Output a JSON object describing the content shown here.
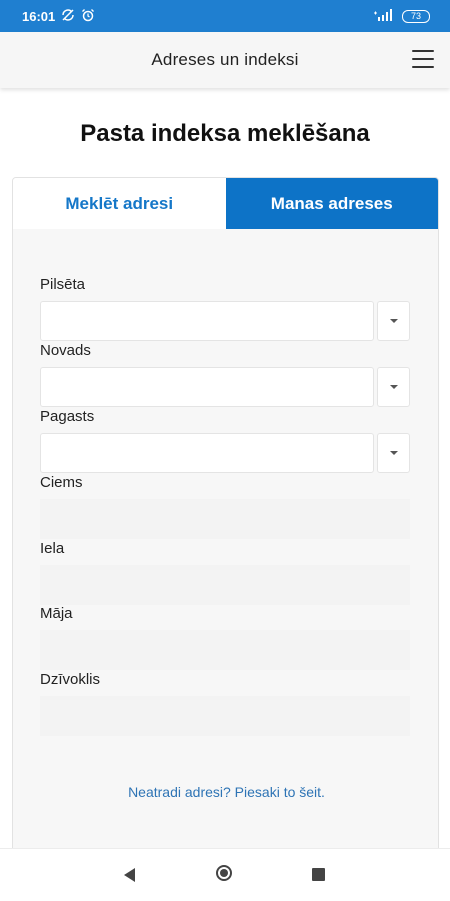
{
  "status_bar": {
    "time": "16:01",
    "battery": "73",
    "icons": [
      "sync-off-icon",
      "alarm-icon",
      "signal-icon",
      "battery-icon"
    ]
  },
  "app_bar": {
    "title": "Adreses un indeksi",
    "menu_icon": "hamburger-menu-icon"
  },
  "page": {
    "title": "Pasta indeksa meklēšana"
  },
  "tabs": [
    {
      "label": "Meklēt adresi",
      "active": true
    },
    {
      "label": "Manas adreses",
      "active": false
    }
  ],
  "form": {
    "fields": [
      {
        "label": "Pilsēta",
        "value": "",
        "type": "select"
      },
      {
        "label": "Novads",
        "value": "",
        "type": "select"
      },
      {
        "label": "Pagasts",
        "value": "",
        "type": "select"
      },
      {
        "label": "Ciems",
        "value": "",
        "type": "text"
      },
      {
        "label": "Iela",
        "value": "",
        "type": "text"
      },
      {
        "label": "Māja",
        "value": "",
        "type": "text"
      },
      {
        "label": "Dzīvoklis",
        "value": "",
        "type": "text"
      }
    ],
    "help_link": "Neatradi adresi? Piesaki to šeit."
  },
  "colors": {
    "accent": "#0d73c7",
    "status_bar": "#1f7fd0",
    "link": "#2e74b5"
  },
  "nav_bar": {
    "icons": [
      "back-icon",
      "home-icon",
      "recents-icon"
    ]
  }
}
